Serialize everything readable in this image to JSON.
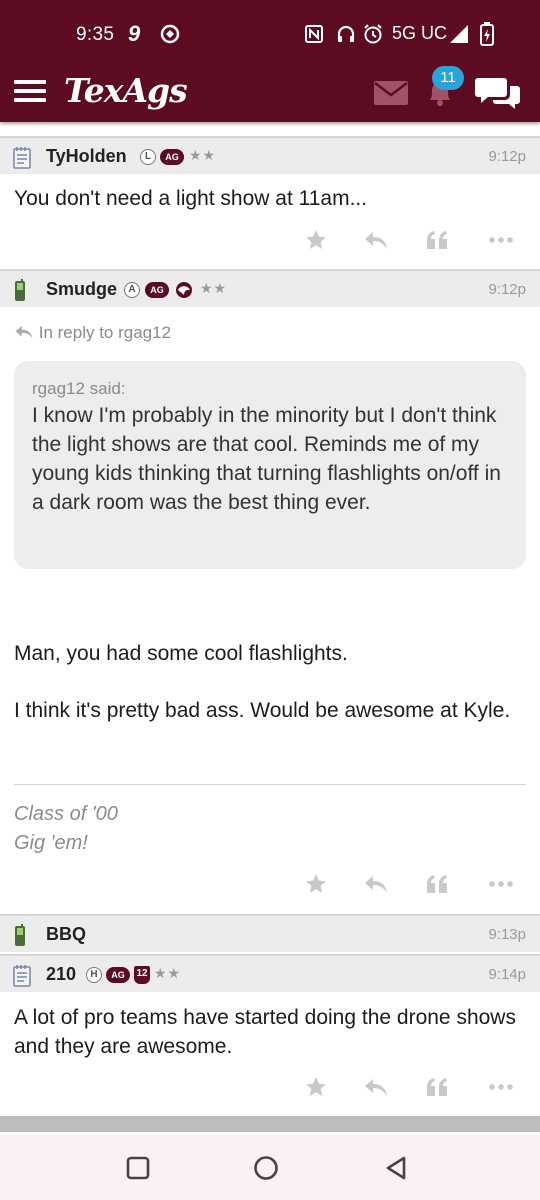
{
  "status_bar": {
    "time": "9:35",
    "network": "5G UC",
    "icons": [
      "notification-9-icon",
      "vpn-icon",
      "nfc-icon",
      "headphones-icon",
      "alarm-icon",
      "signal-icon",
      "battery-charging-icon"
    ]
  },
  "app_bar": {
    "logo": "TexAgs",
    "notification_count": "11",
    "colors": {
      "brand": "#5c0b23",
      "badge": "#2aa3d8"
    }
  },
  "posts": [
    {
      "username": "TyHolden",
      "rank_letter": "L",
      "ag_label": "AG",
      "stars": "★★",
      "time": "9:12p",
      "body": "You don't need a light show at 11am..."
    },
    {
      "username": "Smudge",
      "rank_letter": "A",
      "ag_label": "AG",
      "stars": "★★",
      "time": "9:12p",
      "reply_to": "In reply to rgag12",
      "quote_author": "rgag12 said:",
      "quote_text": "I know I'm probably in the minority but I don't think the light shows are that cool. Reminds me of my young kids thinking that turning flashlights on/off in a dark room was the best thing ever.",
      "body_1": "Man, you had some cool flashlights.",
      "body_2": "I think it's pretty bad ass. Would be awesome at Kyle.",
      "signature_1": "Class of '00",
      "signature_2": "Gig 'em!"
    },
    {
      "username": "BBQ",
      "time": "9:13p"
    },
    {
      "username": "210",
      "rank_letter": "H",
      "ag_label": "AG",
      "badge_number": "12",
      "stars": "★★",
      "time": "9:14p",
      "body": "A lot of pro teams have started doing the drone shows and they are awesome."
    }
  ]
}
